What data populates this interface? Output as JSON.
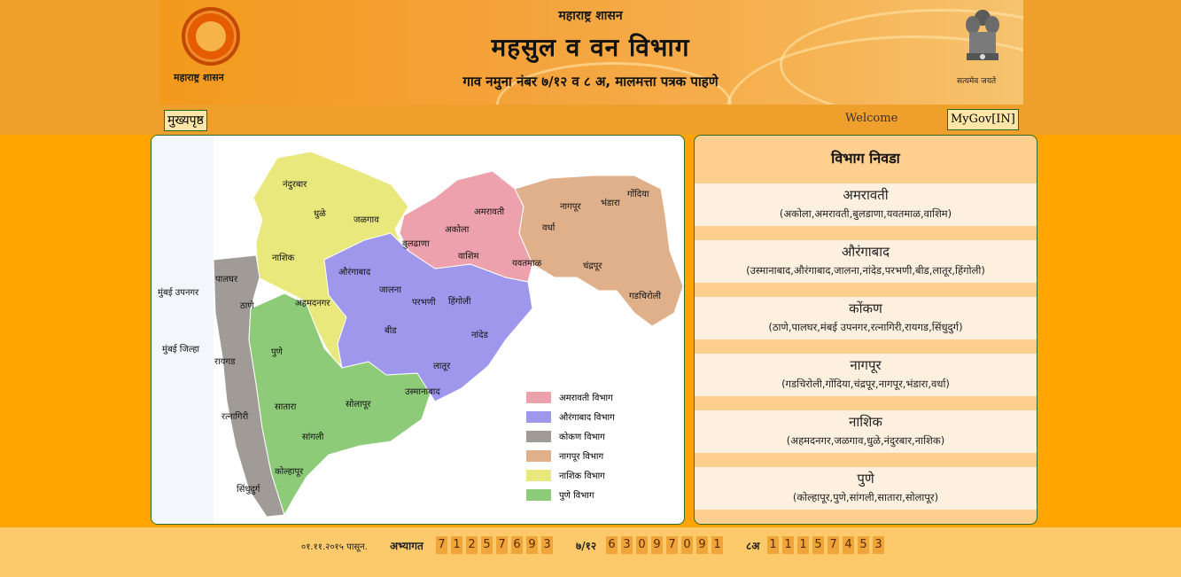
{
  "header": {
    "logo_text": "महाराष्ट्र शासन",
    "top": "महाराष्ट्र शासन",
    "title": "महसुल व वन विभाग",
    "subtitle": "गाव नमुना नंबर ७/१२ व ८ अ, मालमत्ता पत्रक पाहणे",
    "emblem_text": "सत्यमेव जयते"
  },
  "nav": {
    "home": "मुख्यपृष्ठ",
    "welcome": "Welcome",
    "mygov": "MyGov[IN]"
  },
  "map": {
    "labels": {
      "nandurbar": "नंदुरबार",
      "dhule": "धुळे",
      "jalgaon": "जळगाव",
      "nashik": "नाशिक",
      "ahmednagar": "अहमदनगर",
      "palghar": "पालघर",
      "thane": "ठाणे",
      "mumbai_suburban": "मुंबई उपनगर",
      "mumbai_city": "मुंबई जिल्हा",
      "raigad": "रायगड",
      "ratnagiri": "रत्नागिरी",
      "sindhudurg": "सिंधुदुर्ग",
      "pune": "पुणे",
      "satara": "सातारा",
      "sangli": "सांगली",
      "kolhapur": "कोल्हापूर",
      "solapur": "सोलापूर",
      "aurangabad": "औरंगाबाद",
      "jalna": "जालना",
      "beed": "बीड",
      "parbhani": "परभणी",
      "hingoli": "हिंगोली",
      "nanded": "नांदेड",
      "latur": "लातूर",
      "osmanabad": "उस्मानाबाद",
      "buldhana": "बुलढाणा",
      "akola": "अकोला",
      "washim": "वाशिम",
      "amravati": "अमरावती",
      "yavatmal": "यवतमाळ",
      "nagpur": "नागपूर",
      "wardha": "वर्धा",
      "bhandara": "भंडारा",
      "gondia": "गोंदिया",
      "chandrapur": "चंद्रपूर",
      "gadchiroli": "गडचिरोली"
    },
    "legend": [
      {
        "label": "अमरावती विभाग",
        "color": "#eda1ad"
      },
      {
        "label": "औरंगाबाद विभाग",
        "color": "#9e97ec"
      },
      {
        "label": "कोकण विभाग",
        "color": "#a19b98"
      },
      {
        "label": "नागपूर विभाग",
        "color": "#dfb08a"
      },
      {
        "label": "नाशिक विभाग",
        "color": "#e8e87c"
      },
      {
        "label": "पुणे विभाग",
        "color": "#8dcb79"
      }
    ]
  },
  "divisions": {
    "heading": "विभाग निवडा",
    "items": [
      {
        "name": "अमरावती",
        "districts": "(अकोला,अमरावती,बुलडाणा,यवतमाळ,वाशिम)"
      },
      {
        "name": "औरंगाबाद",
        "districts": "(उस्मानाबाद,औरंगाबाद,जालना,नांदेड,परभणी,बीड,लातूर,हिंगोली)"
      },
      {
        "name": "कोंकण",
        "districts": "(ठाणे,पालघर,मंबई उपनगर,रत्नागिरी,रायगड,सिंधुदुर्ग)"
      },
      {
        "name": "नागपूर",
        "districts": "(गडचिरोली,गोंदिया,चंद्रपूर,नागपूर,भंडारा,वर्धा)"
      },
      {
        "name": "नाशिक",
        "districts": "(अहमदनगर,जळगाव,धुळे,नंदुरबार,नाशिक)"
      },
      {
        "name": "पुणे",
        "districts": "(कोल्हापूर,पुणे,सांगली,सातारा,सोलापूर)"
      }
    ]
  },
  "footer": {
    "since": "०१.११.२०१५ पासून.",
    "visitors_label": "अभ्यागत",
    "visitors_digits": [
      "7",
      "1",
      "2",
      "5",
      "7",
      "6",
      "9",
      "3"
    ],
    "s712_label": "७/१२",
    "s712_digits": [
      "6",
      "3",
      "0",
      "9",
      "7",
      "0",
      "9",
      "1"
    ],
    "s8a_label": "८अ",
    "s8a_digits": [
      "1",
      "1",
      "1",
      "5",
      "7",
      "4",
      "5",
      "3"
    ]
  }
}
